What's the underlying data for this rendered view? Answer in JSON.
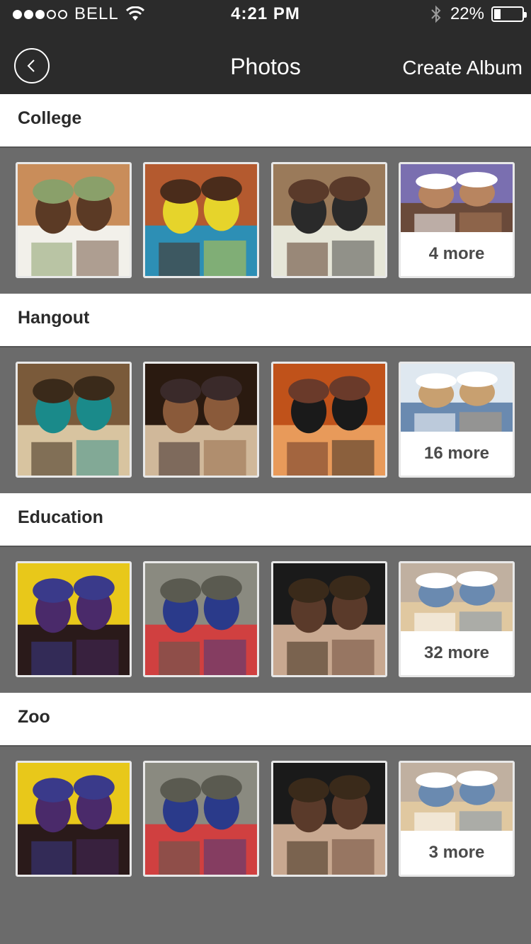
{
  "status_bar": {
    "carrier": "BELL",
    "time": "4:21 PM",
    "battery": "22%",
    "battery_level": 0.22,
    "signal_dots_filled": 3,
    "signal_dots_total": 5
  },
  "nav": {
    "title": "Photos",
    "create_album_label": "Create Album",
    "back_icon": "chevron-left-icon"
  },
  "albums": [
    {
      "title": "College",
      "more_label": "4 more",
      "thumbs": [
        {
          "icon": "photo-two-women-smiling",
          "colors": [
            "#c98d5a",
            "#5b3a25",
            "#f2f0ea",
            "#8aa06a"
          ]
        },
        {
          "icon": "photo-two-young-men",
          "colors": [
            "#b45a2f",
            "#e6d42b",
            "#2d8fb5",
            "#4a2c1b"
          ]
        },
        {
          "icon": "photo-group-students",
          "colors": [
            "#9a7a5a",
            "#2a2a2a",
            "#e6e6d8",
            "#5a3a2a"
          ]
        },
        {
          "icon": "photo-woman-close-up",
          "colors": [
            "#7a6fb0",
            "#b88560",
            "#6a4a3a",
            "#ffffff"
          ]
        }
      ]
    },
    {
      "title": "Hangout",
      "more_label": "16 more",
      "thumbs": [
        {
          "icon": "photo-friends-selfie",
          "colors": [
            "#7a5a3a",
            "#1a8a8a",
            "#d8c4a0",
            "#3a2a1a"
          ]
        },
        {
          "icon": "photo-couple-sunglasses",
          "colors": [
            "#2a1a10",
            "#8a5a3a",
            "#d0b89a",
            "#3a2a2a"
          ]
        },
        {
          "icon": "photo-friends-at-movie",
          "colors": [
            "#c0521a",
            "#1a1a1a",
            "#e89a5a",
            "#6a3a2a"
          ]
        },
        {
          "icon": "photo-beach-friends",
          "colors": [
            "#dfe8f0",
            "#c8a070",
            "#6a8ab0",
            "#ffffff"
          ]
        }
      ]
    },
    {
      "title": "Education",
      "more_label": "32 more",
      "thumbs": [
        {
          "icon": "photo-graduates-yellow",
          "colors": [
            "#e8c81a",
            "#4a2a6a",
            "#2a1a1a",
            "#3a3a8a"
          ]
        },
        {
          "icon": "photo-graduate-in-doorway",
          "colors": [
            "#8a8a80",
            "#2a3a8a",
            "#d04040",
            "#5a5a50"
          ]
        },
        {
          "icon": "photo-graduates-selfie",
          "colors": [
            "#1a1a1a",
            "#5a3a2a",
            "#c8a890",
            "#3a2a1a"
          ]
        },
        {
          "icon": "photo-students-in-class",
          "colors": [
            "#c0b0a0",
            "#6a8ab0",
            "#e0c8a0",
            "#ffffff"
          ]
        }
      ]
    },
    {
      "title": "Zoo",
      "more_label": "3 more",
      "thumbs": [
        {
          "icon": "photo-graduates-yellow",
          "colors": [
            "#e8c81a",
            "#4a2a6a",
            "#2a1a1a",
            "#3a3a8a"
          ]
        },
        {
          "icon": "photo-graduate-in-doorway",
          "colors": [
            "#8a8a80",
            "#2a3a8a",
            "#d04040",
            "#5a5a50"
          ]
        },
        {
          "icon": "photo-graduates-selfie",
          "colors": [
            "#1a1a1a",
            "#5a3a2a",
            "#c8a890",
            "#3a2a1a"
          ]
        },
        {
          "icon": "photo-students-in-class",
          "colors": [
            "#c0b0a0",
            "#6a8ab0",
            "#e0c8a0",
            "#ffffff"
          ]
        }
      ]
    }
  ]
}
